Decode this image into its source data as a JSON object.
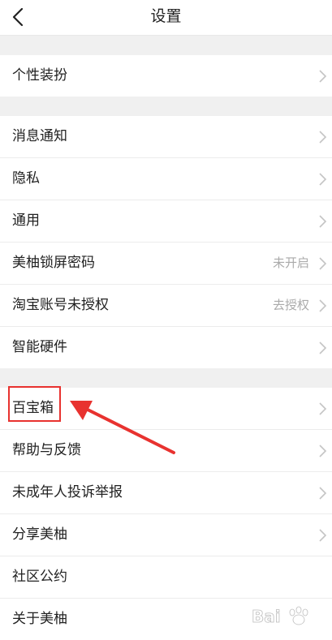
{
  "header": {
    "title": "设置"
  },
  "groups": [
    {
      "items": [
        {
          "label": "个性装扮",
          "value": ""
        }
      ]
    },
    {
      "items": [
        {
          "label": "消息通知",
          "value": ""
        },
        {
          "label": "隐私",
          "value": ""
        },
        {
          "label": "通用",
          "value": ""
        },
        {
          "label": "美柚锁屏密码",
          "value": "未开启"
        },
        {
          "label": "淘宝账号未授权",
          "value": "去授权"
        },
        {
          "label": "智能硬件",
          "value": ""
        }
      ]
    },
    {
      "items": [
        {
          "label": "百宝箱",
          "value": ""
        },
        {
          "label": "帮助与反馈",
          "value": ""
        },
        {
          "label": "未成年人投诉举报",
          "value": ""
        },
        {
          "label": "分享美柚",
          "value": ""
        },
        {
          "label": "社区公约",
          "value": ""
        },
        {
          "label": "关于美柚",
          "value": ""
        }
      ]
    }
  ],
  "annotation": {
    "color": "#e8322f"
  },
  "watermark": {
    "text": "Bai"
  }
}
